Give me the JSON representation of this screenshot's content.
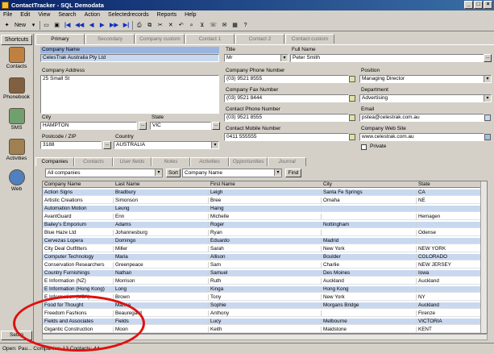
{
  "window": {
    "title": "ContactTracker - SQL Demodata"
  },
  "menu": [
    "File",
    "Edit",
    "View",
    "Search",
    "Action",
    "Selectedrecords",
    "Reports",
    "Help"
  ],
  "toolbar": {
    "new_label": "New"
  },
  "sidebar": {
    "header": "Shortcuts",
    "items": [
      {
        "label": "Contacts",
        "color": "#c08040"
      },
      {
        "label": "Phonebook",
        "color": "#806040"
      },
      {
        "label": "SMS",
        "color": "#70a070"
      },
      {
        "label": "Activities",
        "color": "#a08050"
      },
      {
        "label": "Web",
        "color": "#5080c0"
      }
    ],
    "setup": "Setup"
  },
  "tabs": [
    "Primary",
    "Secondary",
    "Company custom",
    "Contact 1",
    "Contact 2",
    "Contact custom"
  ],
  "form": {
    "company_name": {
      "label": "Company Name",
      "value": "CelesTrak Australia Pty Ltd"
    },
    "company_address": {
      "label": "Company Address",
      "value": "25 Small St"
    },
    "city": {
      "label": "City",
      "value": "HAMPTON"
    },
    "state": {
      "label": "State",
      "value": "VIC"
    },
    "postcode": {
      "label": "Postcode / ZIP",
      "value": "3188"
    },
    "country": {
      "label": "Country",
      "value": "AUSTRALIA"
    },
    "title": {
      "label": "Title",
      "value": "Mr"
    },
    "full_name": {
      "label": "Full Name",
      "value": "Peter Smith"
    },
    "company_phone": {
      "label": "Company Phone Number",
      "value": "(03) 9521 8555"
    },
    "company_fax": {
      "label": "Company Fax Number",
      "value": "(03) 9521 8444"
    },
    "contact_phone": {
      "label": "Contact Phone Number",
      "value": "(03) 9521 8555"
    },
    "contact_mobile": {
      "label": "Contact Mobile Number",
      "value": "0411 555555"
    },
    "position": {
      "label": "Position",
      "value": "Managing Director"
    },
    "department": {
      "label": "Department",
      "value": "Advertising"
    },
    "email": {
      "label": "Email",
      "value": "pstea@celestrak.com.au"
    },
    "website": {
      "label": "Company Web Site",
      "value": "www.celestrak.com.au"
    },
    "private": {
      "label": "Private"
    }
  },
  "subtabs": [
    "Companies",
    "Contacts",
    "User fields",
    "Notes",
    "Activities",
    "Opportunities",
    "Journal"
  ],
  "filter": {
    "scope": "All companies",
    "sort_label": "Sort",
    "sort_field": "Company Name",
    "find_label": "Find"
  },
  "grid": {
    "columns": [
      "Company Name",
      "Last Name",
      "First Name",
      "City",
      "State"
    ],
    "rows": [
      [
        "Action Signs",
        "Bradbury",
        "Leigh",
        "Santa Fe Springs",
        "CA"
      ],
      [
        "Artistic Creations",
        "Simonson",
        "Bree",
        "Omaha",
        "NE"
      ],
      [
        "Automation Motion",
        "Leung",
        "Haing",
        "",
        ""
      ],
      [
        "AvantGuard",
        "Enn",
        "Michelle",
        "",
        "Hemagen"
      ],
      [
        "Bailey's Emporium",
        "Adams",
        "Roger",
        "Nottingham",
        ""
      ],
      [
        "Blue Haze Ltd",
        "Johannesburg",
        "Ryan",
        "",
        "Odense"
      ],
      [
        "Cervezas Lopera",
        "Domingo",
        "Eduardo",
        "Madrid",
        ""
      ],
      [
        "City Deal Outfitters",
        "Miller",
        "Sarah",
        "New York",
        "NEW YORK"
      ],
      [
        "Computer Technology",
        "Maria",
        "Allison",
        "Boulder",
        "COLORADO"
      ],
      [
        "Conservation Researchers",
        "Greenpeace",
        "Sam",
        "Charlie",
        "NEW JERSEY"
      ],
      [
        "Country Furnishings",
        "Nathan",
        "Samuel",
        "Des Moines",
        "Iowa"
      ],
      [
        "E Information (NZ)",
        "Morrison",
        "Ruth",
        "Auckland",
        "Auckland"
      ],
      [
        "E Information (Hong Kong)",
        "Long",
        "Kinga",
        "Hong Kong",
        ""
      ],
      [
        "E Information (USA)",
        "Brown",
        "Tony",
        "New York",
        "NY"
      ],
      [
        "Food for Thought",
        "Manne",
        "Sophie",
        "Morgans Bridge",
        "Auckland"
      ],
      [
        "Freedom Fashions",
        "Beauregard",
        "Anthony",
        "",
        "Firenze"
      ],
      [
        "Fields and Associates",
        "Fields",
        "Lucy",
        "Melbourne",
        "VICTORIA"
      ],
      [
        "Gigantic Construction",
        "Moon",
        "Keith",
        "Maidstone",
        "KENT"
      ]
    ]
  },
  "status": {
    "text": "Open: Pau... Companies: 13  Contacts: 44"
  }
}
